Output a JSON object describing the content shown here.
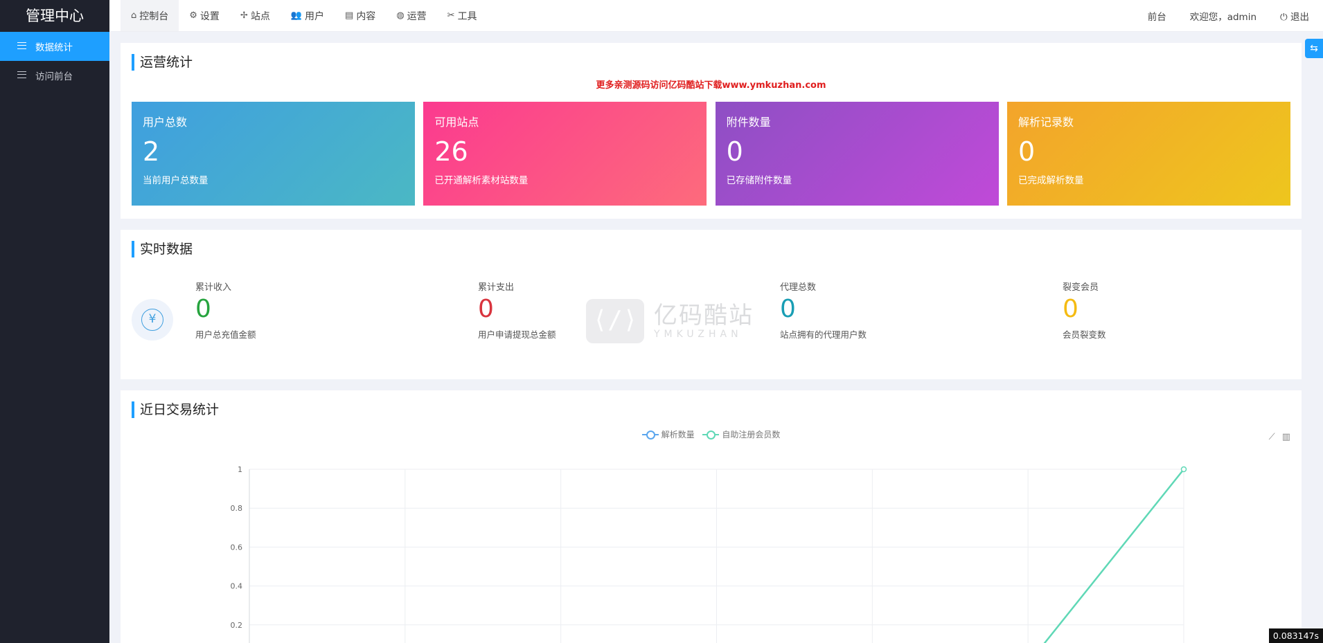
{
  "sidebar": {
    "title": "管理中心",
    "items": [
      {
        "label": "数据统计",
        "active": true
      },
      {
        "label": "访问前台",
        "active": false
      }
    ]
  },
  "topnav": {
    "items": [
      {
        "label": "控制台",
        "icon": "home-icon",
        "glyph": "⌂"
      },
      {
        "label": "设置",
        "icon": "gear-icon",
        "glyph": "⚙"
      },
      {
        "label": "站点",
        "icon": "fan-icon",
        "glyph": "✢"
      },
      {
        "label": "用户",
        "icon": "users-icon",
        "glyph": "👥"
      },
      {
        "label": "内容",
        "icon": "document-icon",
        "glyph": "▤"
      },
      {
        "label": "运营",
        "icon": "globe-icon",
        "glyph": "◍"
      },
      {
        "label": "工具",
        "icon": "tools-icon",
        "glyph": "✂"
      }
    ],
    "right": {
      "front": "前台",
      "welcome": "欢迎您，admin",
      "logout_glyph": "⏻",
      "logout": "退出"
    }
  },
  "float_button_glyph": "⇆",
  "ops": {
    "title": "运营统计",
    "promo": "更多亲测源码访问亿码酷站下载www.ymkuzhan.com",
    "cards": [
      {
        "title": "用户总数",
        "value": "2",
        "desc": "当前用户总数量"
      },
      {
        "title": "可用站点",
        "value": "26",
        "desc": "已开通解析素材站数量"
      },
      {
        "title": "附件数量",
        "value": "0",
        "desc": "已存储附件数量"
      },
      {
        "title": "解析记录数",
        "value": "0",
        "desc": "已完成解析数量"
      }
    ]
  },
  "realtime": {
    "title": "实时数据",
    "yen_glyph": "¥",
    "stats": [
      {
        "label": "累计收入",
        "value": "0",
        "desc": "用户总充值金额",
        "color": "#27a43f"
      },
      {
        "label": "累计支出",
        "value": "0",
        "desc": "用户申请提现总金额",
        "color": "#d9343e"
      },
      {
        "label": "代理总数",
        "value": "0",
        "desc": "站点拥有的代理用户数",
        "color": "#199eb4"
      },
      {
        "label": "裂变会员",
        "value": "0",
        "desc": "会员裂变数",
        "color": "#f5bb12"
      }
    ],
    "watermark": {
      "logo": "⟨/⟩",
      "cn": "亿码酷站",
      "en": "YMKUZHAN"
    }
  },
  "trade": {
    "title": "近日交易统计",
    "tools": {
      "line": "⟋",
      "bar": "▥"
    }
  },
  "chart_data": {
    "type": "line",
    "ylim": [
      0,
      1
    ],
    "yticks": [
      "0.2",
      "0.4",
      "0.6",
      "0.8",
      "1"
    ],
    "x_count": 7,
    "series": [
      {
        "name": "解析数量",
        "color": "#5aa6ee",
        "values": [
          0,
          0,
          0,
          0,
          0,
          0,
          0
        ]
      },
      {
        "name": "自助注册会员数",
        "color": "#5fd8b6",
        "values": [
          0,
          0,
          0,
          0,
          0,
          0,
          1
        ]
      }
    ]
  },
  "timer": "0.083147s"
}
